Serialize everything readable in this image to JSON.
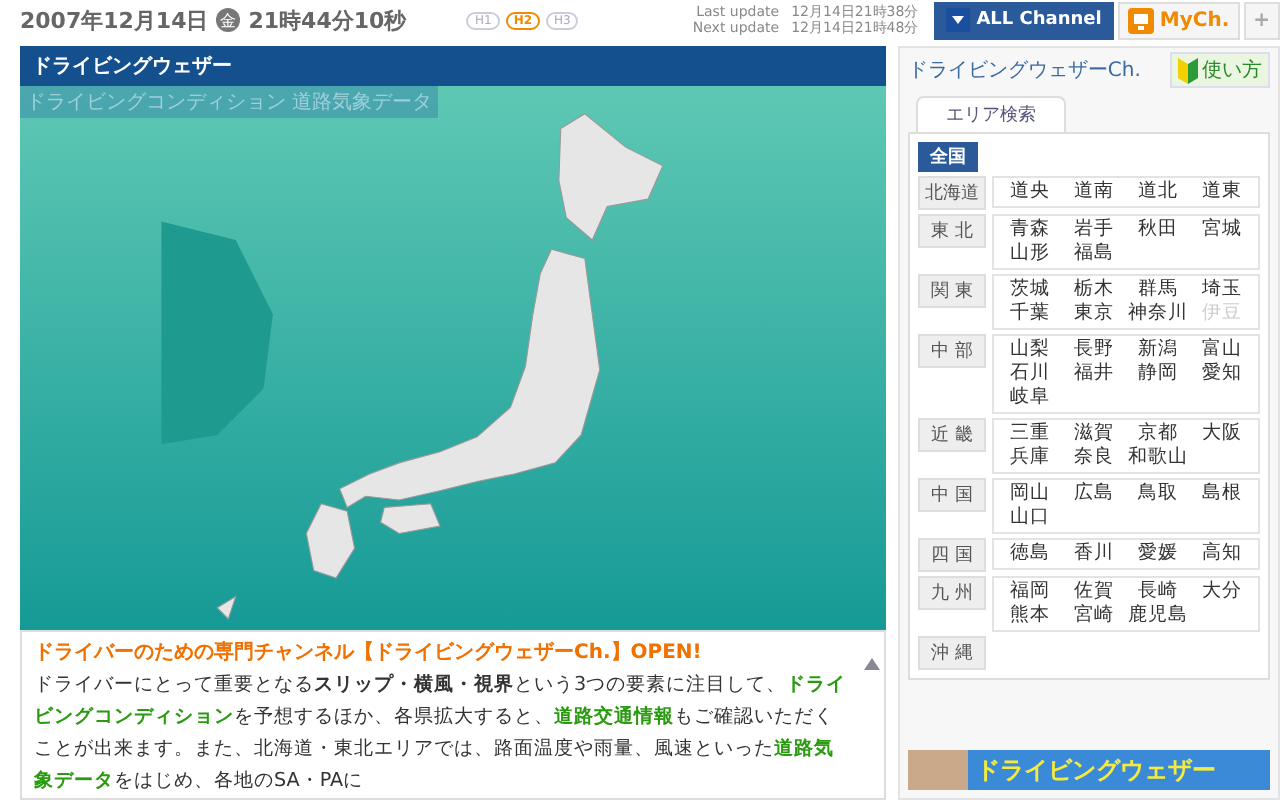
{
  "header": {
    "date": "2007年12月14日",
    "weekday": "金",
    "time": "21時44分10秒",
    "levels": [
      {
        "label": "H1",
        "selected": false
      },
      {
        "label": "H2",
        "selected": true
      },
      {
        "label": "H3",
        "selected": false
      }
    ],
    "last_update": {
      "label": "Last update",
      "value": "12月14日21時38分"
    },
    "next_update": {
      "label": "Next update",
      "value": "12月14日21時48分"
    },
    "channels": [
      {
        "label": "ALL Channel",
        "kind": "all"
      },
      {
        "label": "MyCh.",
        "kind": "my"
      },
      {
        "label": "+",
        "kind": "add"
      }
    ]
  },
  "main": {
    "title": "ドライビングウェザー",
    "subtitle": "ドライビングコンディション 道路気象データ",
    "headline": "ドライバーのための専門チャンネル【ドライビングウェザーCh.】OPEN!",
    "paragraph": [
      {
        "text": "ドライバーにとって重要となる",
        "kind": "plain"
      },
      {
        "text": "スリップ・横風・視界",
        "kind": "bold"
      },
      {
        "text": "という3つの要素に注目して、",
        "kind": "plain"
      },
      {
        "text": "ドライビングコンディション",
        "kind": "green"
      },
      {
        "text": "を予想するほか、各県拡大すると、",
        "kind": "plain"
      },
      {
        "text": "道路交通情報",
        "kind": "green"
      },
      {
        "text": "もご確認いただくことが出来ます。また、北海道・東北エリアでは、路面温度や雨量、風速といった",
        "kind": "plain"
      },
      {
        "text": "道路気象データ",
        "kind": "green"
      },
      {
        "text": "をはじめ、各地のSA・PAに",
        "kind": "plain"
      }
    ]
  },
  "sidebar": {
    "title": "ドライビングウェザーCh.",
    "help": "使い方",
    "tab": "エリア検索",
    "all": "全国",
    "regions": [
      {
        "name": "北海道",
        "prefs": [
          {
            "name": "道央",
            "disabled": false
          },
          {
            "name": "道南",
            "disabled": false
          },
          {
            "name": "道北",
            "disabled": false
          },
          {
            "name": "道東",
            "disabled": false
          }
        ]
      },
      {
        "name": "東 北",
        "prefs": [
          {
            "name": "青森",
            "disabled": false
          },
          {
            "name": "岩手",
            "disabled": false
          },
          {
            "name": "秋田",
            "disabled": false
          },
          {
            "name": "宮城",
            "disabled": false
          },
          {
            "name": "山形",
            "disabled": false
          },
          {
            "name": "福島",
            "disabled": false
          }
        ]
      },
      {
        "name": "関 東",
        "prefs": [
          {
            "name": "茨城",
            "disabled": false
          },
          {
            "name": "栃木",
            "disabled": false
          },
          {
            "name": "群馬",
            "disabled": false
          },
          {
            "name": "埼玉",
            "disabled": false
          },
          {
            "name": "千葉",
            "disabled": false
          },
          {
            "name": "東京",
            "disabled": false
          },
          {
            "name": "神奈川",
            "disabled": false
          },
          {
            "name": "伊豆",
            "disabled": true
          }
        ]
      },
      {
        "name": "中 部",
        "prefs": [
          {
            "name": "山梨",
            "disabled": false
          },
          {
            "name": "長野",
            "disabled": false
          },
          {
            "name": "新潟",
            "disabled": false
          },
          {
            "name": "富山",
            "disabled": false
          },
          {
            "name": "石川",
            "disabled": false
          },
          {
            "name": "福井",
            "disabled": false
          },
          {
            "name": "静岡",
            "disabled": false
          },
          {
            "name": "愛知",
            "disabled": false
          },
          {
            "name": "岐阜",
            "disabled": false
          }
        ]
      },
      {
        "name": "近 畿",
        "prefs": [
          {
            "name": "三重",
            "disabled": false
          },
          {
            "name": "滋賀",
            "disabled": false
          },
          {
            "name": "京都",
            "disabled": false
          },
          {
            "name": "大阪",
            "disabled": false
          },
          {
            "name": "兵庫",
            "disabled": false
          },
          {
            "name": "奈良",
            "disabled": false
          },
          {
            "name": "和歌山",
            "disabled": false
          }
        ]
      },
      {
        "name": "中 国",
        "prefs": [
          {
            "name": "岡山",
            "disabled": false
          },
          {
            "name": "広島",
            "disabled": false
          },
          {
            "name": "鳥取",
            "disabled": false
          },
          {
            "name": "島根",
            "disabled": false
          },
          {
            "name": "山口",
            "disabled": false
          }
        ]
      },
      {
        "name": "四 国",
        "prefs": [
          {
            "name": "徳島",
            "disabled": false
          },
          {
            "name": "香川",
            "disabled": false
          },
          {
            "name": "愛媛",
            "disabled": false
          },
          {
            "name": "高知",
            "disabled": false
          }
        ]
      },
      {
        "name": "九 州",
        "prefs": [
          {
            "name": "福岡",
            "disabled": false
          },
          {
            "name": "佐賀",
            "disabled": false
          },
          {
            "name": "長崎",
            "disabled": false
          },
          {
            "name": "大分",
            "disabled": false
          },
          {
            "name": "熊本",
            "disabled": false
          },
          {
            "name": "宮崎",
            "disabled": false
          },
          {
            "name": "鹿児島",
            "disabled": false
          }
        ]
      },
      {
        "name": "沖 縄"
      }
    ],
    "banner": "ドライビングウェザー"
  }
}
